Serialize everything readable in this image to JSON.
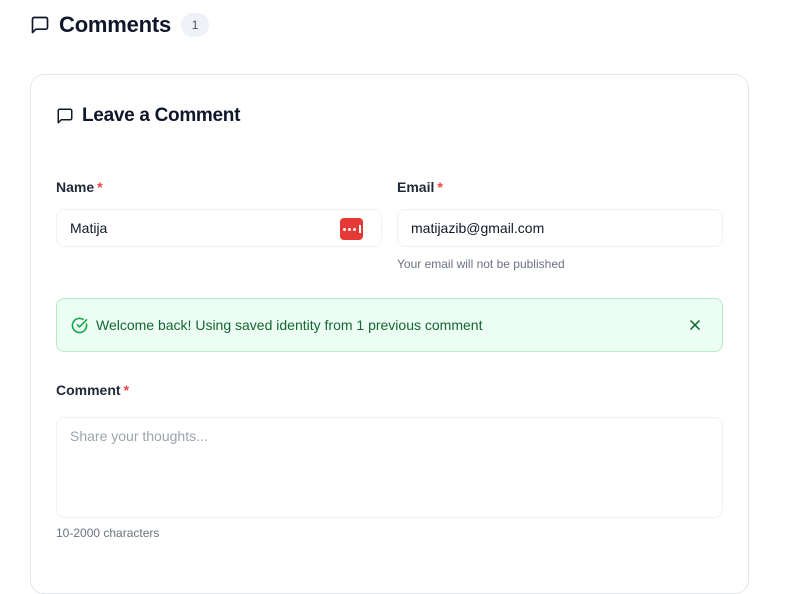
{
  "header": {
    "title": "Comments",
    "count": "1",
    "icon": "message-square-icon"
  },
  "form": {
    "title": "Leave a Comment",
    "icon": "message-square-icon",
    "required_mark": "*",
    "name": {
      "label": "Name",
      "value": "Matija",
      "autofill_icon": "password-manager-icon",
      "autofill_icon_color": "#e53935"
    },
    "email": {
      "label": "Email",
      "value": "matijazib@gmail.com",
      "hint": "Your email will not be published"
    },
    "alert": {
      "message": "Welcome back! Using saved identity from 1 previous comment",
      "icon": "check-circle-icon",
      "close_icon": "close-icon",
      "color": "#166534",
      "background": "#ecfdf3"
    },
    "comment": {
      "label": "Comment",
      "placeholder": "Share your thoughts...",
      "value": "",
      "hint": "10-2000 characters"
    }
  }
}
